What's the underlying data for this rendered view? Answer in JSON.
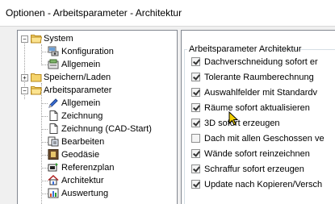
{
  "window": {
    "title": "Optionen - Arbeitsparameter - Architektur"
  },
  "tree": {
    "items": [
      {
        "label": "System",
        "icon": "folder-open-icon"
      },
      {
        "label": "Konfiguration",
        "icon": "config-icon"
      },
      {
        "label": "Allgemein",
        "icon": "general-icon"
      },
      {
        "label": "Speichern/Laden",
        "icon": "folder-closed-icon"
      },
      {
        "label": "Arbeitsparameter",
        "icon": "folder-open-icon"
      },
      {
        "label": "Allgemein",
        "icon": "pencil-icon"
      },
      {
        "label": "Zeichnung",
        "icon": "document-icon"
      },
      {
        "label": "Zeichnung (CAD-Start)",
        "icon": "document-icon"
      },
      {
        "label": "Bearbeiten",
        "icon": "edit-icon"
      },
      {
        "label": "Geodäsie",
        "icon": "geodesy-icon"
      },
      {
        "label": "Referenzplan",
        "icon": "reference-plan-icon"
      },
      {
        "label": "Architektur",
        "icon": "house-icon"
      },
      {
        "label": "Auswertung",
        "icon": "evaluation-icon"
      }
    ],
    "selected": "Architektur"
  },
  "settings": {
    "group_title": "Arbeitsparameter Architektur",
    "options": [
      {
        "label": "Dachverschneidung sofort er",
        "checked": true
      },
      {
        "label": "Tolerante Raumberechnung",
        "checked": true
      },
      {
        "label": "Auswahlfelder mit Standardv",
        "checked": true
      },
      {
        "label": "Räume sofort aktualisieren",
        "checked": true
      },
      {
        "label": "3D sofort erzeugen",
        "checked": true
      },
      {
        "label": "Dach mit allen Geschossen ve",
        "checked": false
      },
      {
        "label": "Wände sofort reinzeichnen",
        "checked": true
      },
      {
        "label": "Schraffur sofort erzeugen",
        "checked": true
      },
      {
        "label": "Update nach Kopieren/Versch",
        "checked": true
      }
    ]
  }
}
